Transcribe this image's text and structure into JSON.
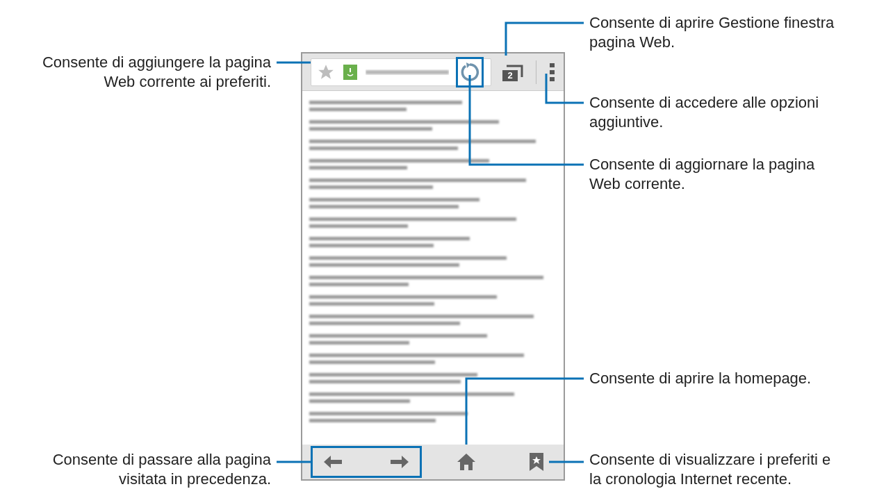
{
  "browser": {
    "tab_count": "2"
  },
  "left_callouts": [
    {
      "lines": [
        "Consente di aggiungere la pagina",
        "Web corrente ai preferiti."
      ]
    },
    {
      "lines": [
        "Consente di passare alla pagina",
        "visitata in precedenza."
      ]
    }
  ],
  "right_callouts": [
    {
      "lines": [
        "Consente di aprire Gestione finestra",
        "pagina Web."
      ]
    },
    {
      "lines": [
        "Consente di accedere alle opzioni",
        "aggiuntive."
      ]
    },
    {
      "lines": [
        "Consente di aggiornare la pagina",
        "Web corrente."
      ]
    },
    {
      "lines": [
        "Consente di aprire la homepage."
      ]
    },
    {
      "lines": [
        "Consente di visualizzare i preferiti e",
        "la cronologia Internet recente."
      ]
    }
  ]
}
